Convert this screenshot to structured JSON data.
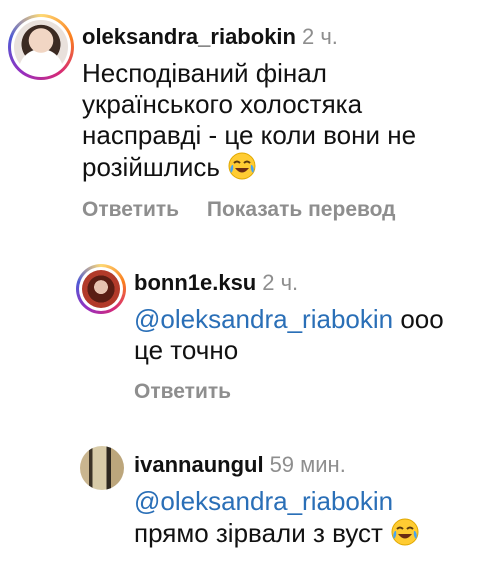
{
  "comments": [
    {
      "username": "oleksandra_riabokin",
      "time": "2 ч.",
      "text": "Несподіваний фінал українського холостяка насправді - це коли вони не розійшлись",
      "emoji": "face-with-tears-of-joy",
      "actions": {
        "reply": "Ответить",
        "translate": "Показать перевод"
      }
    },
    {
      "username": "bonn1e.ksu",
      "time": "2 ч.",
      "mention": "@oleksandra_riabokin",
      "text": "ооо це точно",
      "actions": {
        "reply": "Ответить"
      }
    },
    {
      "username": "ivannaungul",
      "time": "59 мин.",
      "mention": "@oleksandra_riabokin",
      "text": "прямо зірвали з вуст",
      "emoji": "face-with-tears-of-joy"
    }
  ],
  "colors": {
    "text": "#111111",
    "secondary": "#8e8e8e",
    "mention": "#2a6fb7",
    "story_ring": [
      "#feda75",
      "#fa7e1e",
      "#d62976",
      "#962fbf",
      "#4f5bd5"
    ]
  }
}
